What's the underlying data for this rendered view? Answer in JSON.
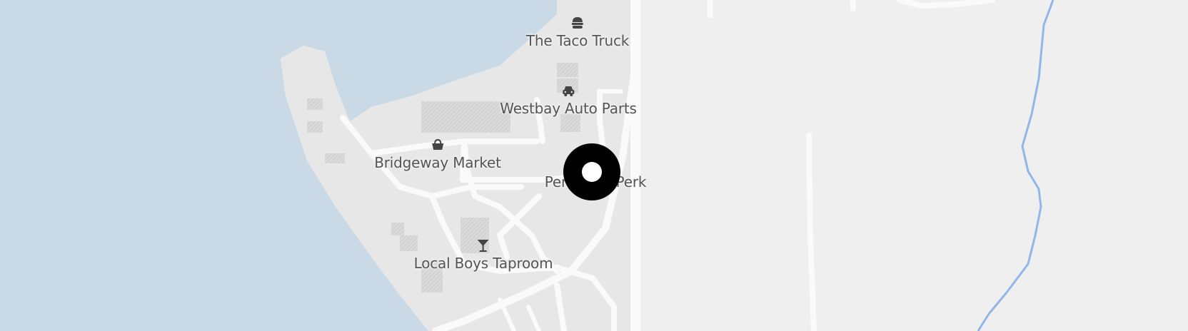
{
  "map": {
    "colors": {
      "water": "#c9d9e6",
      "land_urban": "#e8e8e8",
      "land_open": "#efefef",
      "road": "#fafafa",
      "building": "#d6d6d6",
      "river": "#8fb8e8",
      "label": "#555555",
      "marker": "#000000"
    },
    "pois": [
      {
        "name": "The Taco Truck",
        "icon": "burger-icon"
      },
      {
        "name": "Westbay Auto Parts",
        "icon": "car-icon"
      },
      {
        "name": "Bridgeway Market",
        "icon": "shopping-basket-icon"
      },
      {
        "name": "Peninsula Perk",
        "icon": "coffee-icon"
      },
      {
        "name": "Local Boys Taproom",
        "icon": "cocktail-icon"
      }
    ],
    "marker": {
      "icon": "location-ring-marker-icon"
    }
  }
}
